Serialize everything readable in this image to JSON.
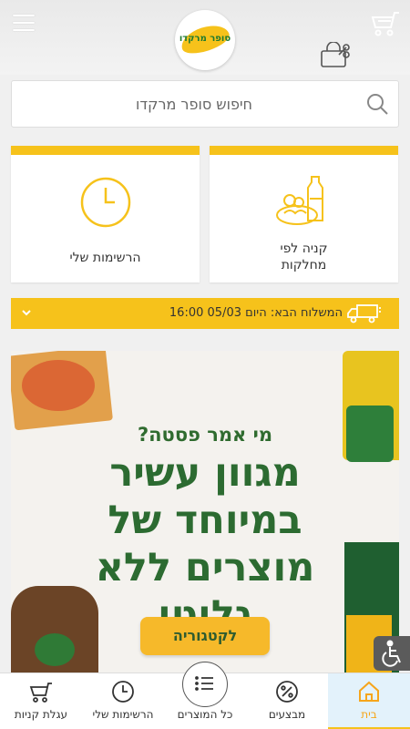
{
  "header": {
    "logo_text": "סופר מרקדו",
    "menu_icon": "hamburger-icon",
    "cart_icon": "cart-icon",
    "bag_icon": "shopping-bag-icon"
  },
  "search": {
    "placeholder": "חיפוש סופר מרקדו",
    "icon": "search-icon"
  },
  "tiles": {
    "lists_label": "הרשימות שלי",
    "category_label_line1": "קניה לפי",
    "category_label_line2": "מחלקות",
    "accent_color": "#f6c21b"
  },
  "delivery": {
    "text": "המשלוח הבא: היום 05/03 16:00"
  },
  "banner": {
    "subtitle": "מי אמר פסטה?",
    "headline": "מגוון עשיר במיוחד של מוצרים ללא גלוטן",
    "cta": "לקטגוריה"
  },
  "nav": {
    "home": "בית",
    "promotions": "מבצעים",
    "all_products": "כל המוצרים",
    "my_lists": "הרשימות שלי",
    "cart": "עגלת קניות"
  }
}
